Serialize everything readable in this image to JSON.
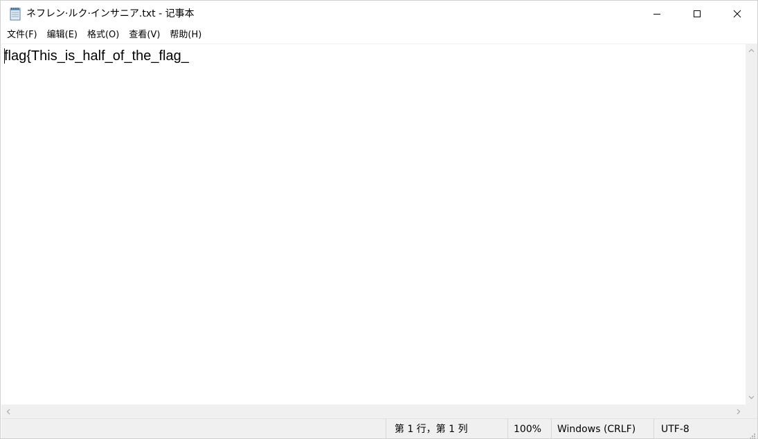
{
  "window": {
    "title": "ネフレン·ルク·インサニア.txt - 记事本",
    "icon": "notepad-icon",
    "controls": {
      "minimize": "minimize-icon",
      "maximize": "maximize-icon",
      "close": "close-icon"
    }
  },
  "menu": {
    "items": [
      {
        "label": "文件(F)"
      },
      {
        "label": "编辑(E)"
      },
      {
        "label": "格式(O)"
      },
      {
        "label": "查看(V)"
      },
      {
        "label": "帮助(H)"
      }
    ]
  },
  "editor": {
    "content": "flag{This_is_half_of_the_flag_"
  },
  "statusbar": {
    "position": "第 1 行，第 1 列",
    "zoom": "100%",
    "line_ending": "Windows (CRLF)",
    "encoding": "UTF-8"
  },
  "colors": {
    "window_bg": "#ffffff",
    "chrome_bg": "#f0f0f0",
    "text": "#000000",
    "scroll_arrow": "#a6a6a6"
  }
}
